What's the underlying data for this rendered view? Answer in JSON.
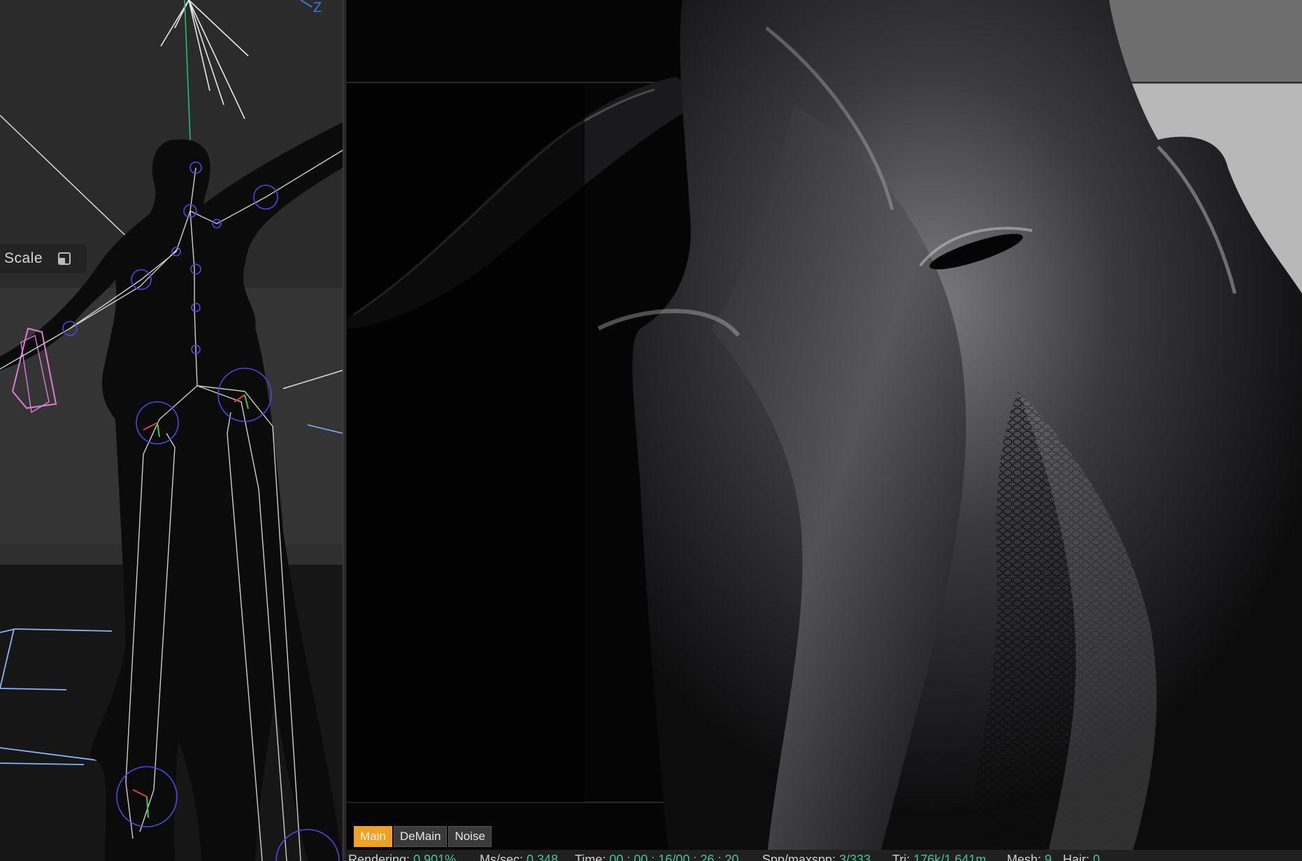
{
  "viewport": {
    "axis_label": "Z",
    "scale_label": "Scale",
    "scale_icon": "frame-scale-icon"
  },
  "render_tabs": [
    {
      "label": "Main",
      "active": true
    },
    {
      "label": "DeMain",
      "active": false
    },
    {
      "label": "Noise",
      "active": false
    }
  ],
  "status": {
    "rendering_label": "Rendering:",
    "rendering_value": "0.901%",
    "mssec_label": "Ms/sec:",
    "mssec_value": "0.348",
    "time_label": "Time:",
    "time_value": "00 : 00 : 16/00 : 26 : 20",
    "spp_label": "Spp/maxspp:",
    "spp_value": "3/333",
    "tri_label": "Tri:",
    "tri_value": "176k/1.641m",
    "mesh_label": "Mesh:",
    "mesh_value": "9",
    "hair_label": "Hair:",
    "hair_value": "0"
  },
  "colors": {
    "accent": "#f0a024",
    "status_value": "#3fc79c",
    "axis_blue": "#3d7bd8",
    "bone_joint": "#4a4ae0"
  }
}
